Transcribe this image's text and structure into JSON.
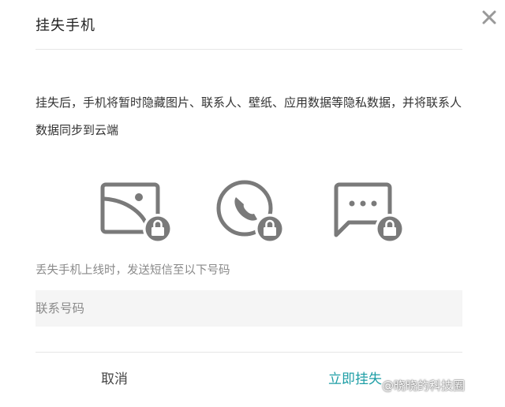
{
  "dialog": {
    "title": "挂失手机",
    "close_icon": "close-icon",
    "description": "挂失后，手机将暂时隐藏图片、联系人、壁纸、应用数据等隐私数据，并将联系人数据同步到云端",
    "icons": [
      "image-lock-icon",
      "phone-lock-icon",
      "message-lock-icon"
    ],
    "hint": "丢失手机上线时，发送短信至以下号码",
    "contact_input": {
      "value": "",
      "placeholder": "联系号码"
    },
    "cancel_label": "取消",
    "confirm_label": "立即挂失",
    "watermark": "@晓晓的科技圈"
  },
  "colors": {
    "accent": "#1e9ea6",
    "icon": "#7a7a7a",
    "divider": "#e6e6e6",
    "input_bg": "#f5f5f5"
  }
}
